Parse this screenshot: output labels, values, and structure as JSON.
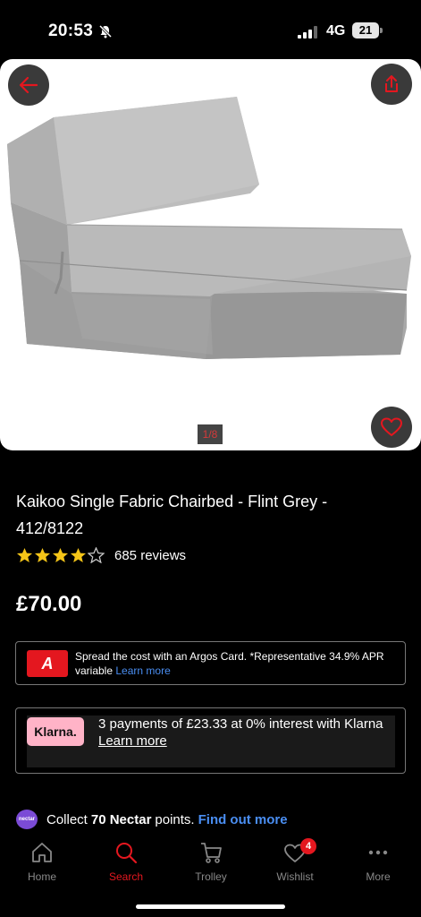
{
  "status_bar": {
    "time": "20:53",
    "network": "4G",
    "battery": "21"
  },
  "gallery": {
    "pager": "1/8"
  },
  "product": {
    "title": "Kaikoo Single Fabric Chairbed - Flint Grey - 412/8122",
    "rating": 4,
    "rating_max": 5,
    "reviews": "685 reviews",
    "price": "£70.00"
  },
  "argos_card": {
    "logo": "A",
    "text": "Spread the cost with an Argos Card. *Representative 34.9% APR variable",
    "link": "Learn more"
  },
  "klarna": {
    "logo": "Klarna.",
    "text": "3 payments of £23.33 at 0% interest with Klarna",
    "link": "Learn more"
  },
  "nectar": {
    "logo": "nectar",
    "prefix": "Collect",
    "points": "70 Nectar",
    "suffix": "points.",
    "link": "Find out more"
  },
  "nav": {
    "items": [
      {
        "label": "Home",
        "icon": "home-icon"
      },
      {
        "label": "Search",
        "icon": "search-icon",
        "active": true
      },
      {
        "label": "Trolley",
        "icon": "trolley-icon"
      },
      {
        "label": "Wishlist",
        "icon": "heart-icon",
        "badge": "4"
      },
      {
        "label": "More",
        "icon": "more-icon"
      }
    ]
  },
  "colors": {
    "accent": "#e4171f",
    "link": "#4a8ef2",
    "klarna_pink": "#ffb3c7",
    "nectar_purple": "#7b4bd6",
    "star": "#f5c518"
  }
}
